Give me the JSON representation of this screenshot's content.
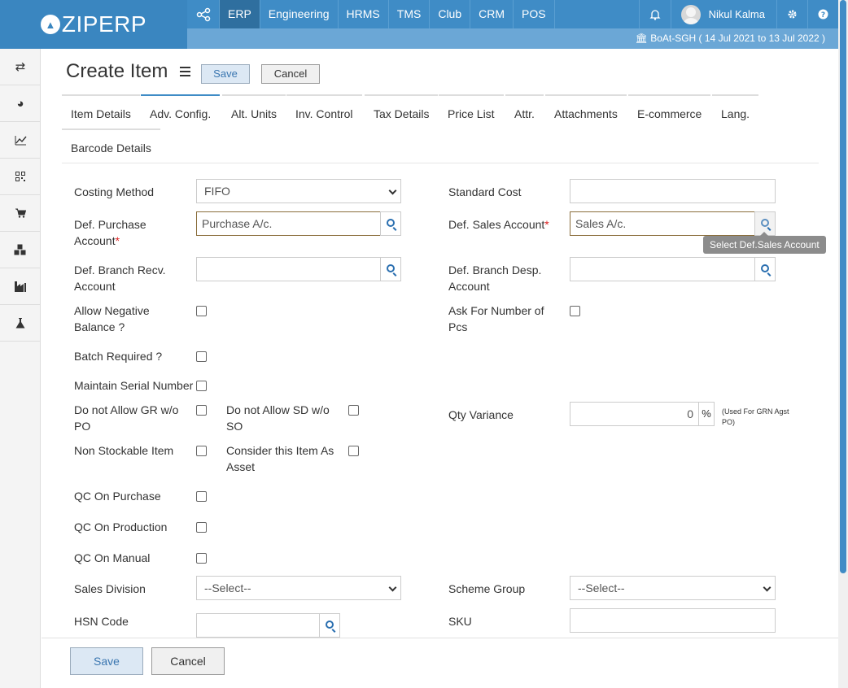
{
  "brand": {
    "name": "ZIPERP"
  },
  "menu": {
    "items": [
      "ERP",
      "Engineering",
      "HRMS",
      "TMS",
      "Club",
      "CRM",
      "POS"
    ],
    "active": "ERP"
  },
  "user": {
    "name": "Nikul Kalma"
  },
  "company_bar": {
    "text": "BoAt-SGH ( 14 Jul 2021 to 13 Jul 2022 )"
  },
  "page": {
    "title": "Create Item",
    "save_label": "Save",
    "cancel_label": "Cancel"
  },
  "tabs": [
    {
      "label": "Item Details"
    },
    {
      "label": "Adv. Config."
    },
    {
      "label": "Alt. Units"
    },
    {
      "label": "Inv. Control"
    },
    {
      "label": "Tax Details"
    },
    {
      "label": "Price List"
    },
    {
      "label": "Attr."
    },
    {
      "label": "Attachments"
    },
    {
      "label": "E-commerce"
    },
    {
      "label": "Lang."
    },
    {
      "label": "Barcode Details"
    }
  ],
  "active_tab": "Adv. Config.",
  "form": {
    "costing_method": {
      "label": "Costing Method",
      "value": "FIFO"
    },
    "standard_cost": {
      "label": "Standard Cost",
      "value": ""
    },
    "def_purchase_account": {
      "label": "Def. Purchase Account",
      "required_mark": "*",
      "value": "Purchase A/c."
    },
    "def_sales_account": {
      "label": "Def. Sales Account",
      "required_mark": "*",
      "value": "Sales A/c.",
      "tooltip": "Select Def.Sales Account"
    },
    "def_branch_recv_account": {
      "label": "Def. Branch Recv. Account",
      "value": ""
    },
    "def_branch_desp_account": {
      "label": "Def. Branch Desp. Account",
      "value": ""
    },
    "allow_negative_balance": {
      "label": "Allow Negative Balance ?",
      "checked": false
    },
    "ask_for_number_of_pcs": {
      "label": "Ask For Number of Pcs",
      "checked": false
    },
    "batch_required": {
      "label": "Batch Required ?",
      "checked": false
    },
    "maintain_serial_number": {
      "label": "Maintain Serial Number",
      "checked": false
    },
    "do_not_allow_gr": {
      "label": "Do not Allow GR w/o PO",
      "checked": false
    },
    "do_not_allow_sd": {
      "label": "Do not Allow SD w/o SO",
      "checked": false
    },
    "qty_variance": {
      "label": "Qty Variance",
      "value": "0",
      "unit": "%",
      "note": "(Used For GRN Agst PO)"
    },
    "non_stockable_item": {
      "label": "Non Stockable Item",
      "checked": false
    },
    "consider_as_asset": {
      "label": "Consider this Item As Asset",
      "checked": false
    },
    "qc_on_purchase": {
      "label": "QC On Purchase",
      "checked": false
    },
    "qc_on_production": {
      "label": "QC On Production",
      "checked": false
    },
    "qc_on_manual": {
      "label": "QC On Manual",
      "checked": false
    },
    "sales_division": {
      "label": "Sales Division",
      "value": "--Select--"
    },
    "scheme_group": {
      "label": "Scheme Group",
      "value": "--Select--"
    },
    "hsn_code": {
      "label": "HSN Code",
      "value": ""
    },
    "sku": {
      "label": "SKU",
      "value": ""
    }
  },
  "footer": {
    "save_label": "Save",
    "cancel_label": "Cancel"
  },
  "colors": {
    "header": "#3f8cc6",
    "header_dark": "#2f6f9f",
    "subbar": "#6ba7d6",
    "link_icon": "#2a6fb0"
  }
}
